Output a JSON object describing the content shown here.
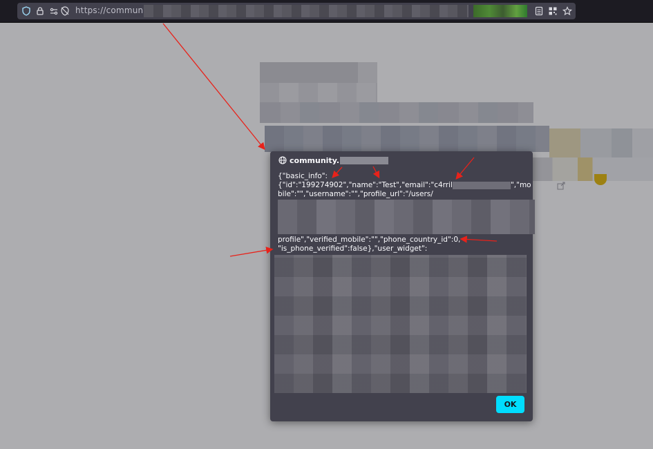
{
  "browser": {
    "url_visible": "https://community",
    "icons": [
      "shield-icon",
      "lock-icon",
      "permissions-icon",
      "tracking-icon",
      "reader-view-icon",
      "qr-code-icon",
      "bookmark-star-icon"
    ]
  },
  "dialog": {
    "origin_label": "community.",
    "message_lines": [
      "{\"basic_info\":",
      "{\"id\":\"199274902\",\"name\":\"Test\",\"email\":\"c4rril",
      "\",\"mo",
      "bile\":\"\",\"username\":\"\",\"profile_url\":\"/users/",
      "profile\",\"verified_mobile\":\"\",\"phone_country_id\":0,",
      "\"is_phone_verified\":false},\"user_widget\":"
    ],
    "ok_label": "OK"
  },
  "colors": {
    "dialog_bg": "#42414d",
    "ok_button": "#00ddff",
    "annotation_arrow": "#e8221a"
  }
}
